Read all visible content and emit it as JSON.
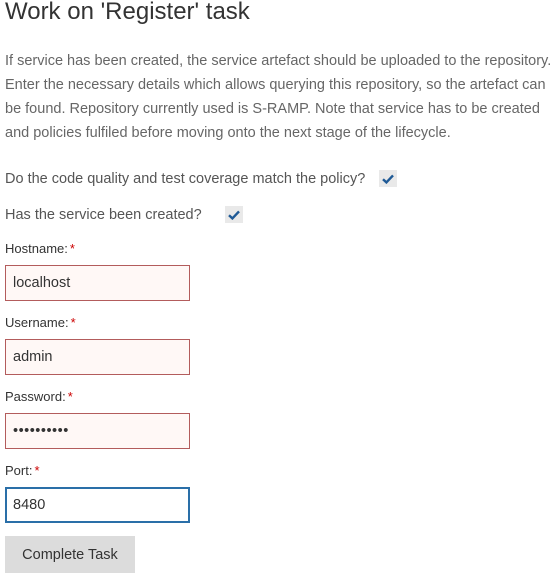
{
  "page": {
    "title": "Work on 'Register' task",
    "intro": "If service has been created, the service artefact should be uploaded to the repository. Enter the necessary details which allows querying this repository, so the artefact can be found. Repository currently used is S-RAMP. Note that service has to be created and policies fulfiled before moving onto the next stage of the lifecycle."
  },
  "checks": [
    {
      "label": "Do the code quality and test coverage match the policy?",
      "checked": true
    },
    {
      "label": "Has the service been created?",
      "checked": true
    }
  ],
  "fields": {
    "hostname": {
      "label": "Hostname:",
      "required_mark": "*",
      "value": "localhost"
    },
    "username": {
      "label": "Username:",
      "required_mark": "*",
      "value": "admin"
    },
    "password": {
      "label": "Password:",
      "required_mark": "*",
      "value": "••••••••••"
    },
    "port": {
      "label": "Port:",
      "required_mark": "*",
      "value": "8480"
    }
  },
  "actions": {
    "complete_label": "Complete Task"
  },
  "colors": {
    "error_border": "#b35c5c",
    "error_background": "#fff8f6",
    "focus_border": "#2a6fa8",
    "required_mark": "#cc0000",
    "check_mark": "#1f5a96"
  }
}
